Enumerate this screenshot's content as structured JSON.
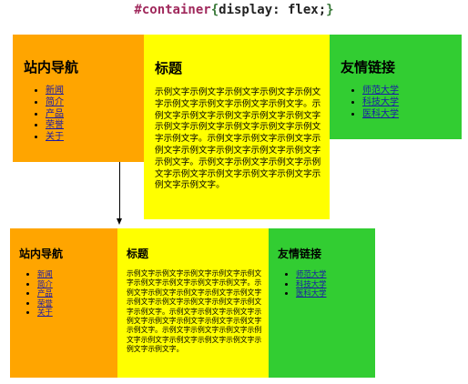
{
  "caption": {
    "selector": "#container",
    "open_brace": "{",
    "declaration": "display: flex;",
    "close_brace": "}"
  },
  "demos": [
    {
      "nav": {
        "title": "站内导航",
        "links": [
          "新闻",
          "简介",
          "产品",
          "荣誉",
          "关于"
        ]
      },
      "main": {
        "title": "标题",
        "text": "示例文字示例文字示例文字示例文字示例文字示例文字示例文字示例文字示例文字。示例文字示例文字示例文字示例文字示例文字示例文字示例文字示例文字示例文字示例文字示例文字。示例文字示例文字示例文字示例文字示例文字示例文字示例文字示例文字示例文字。示例文字示例文字示例文字示例文字示例文字示例文字示例文字示例文字示例文字示例文字。"
      },
      "links": {
        "title": "友情链接",
        "items": [
          "师范大学",
          "科技大学",
          "医科大学"
        ]
      }
    },
    {
      "nav": {
        "title": "站内导航",
        "links": [
          "新闻",
          "简介",
          "产品",
          "荣誉",
          "关于"
        ]
      },
      "main": {
        "title": "标题",
        "text": "示例文字示例文字示例文字示例文字示例文字示例文字示例文字示例文字示例文字。示例文字示例文字示例文字示例文字示例文字示例文字示例文字示例文字示例文字示例文字示例文字。示例文字示例文字示例文字示例文字示例文字示例文字示例文字示例文字示例文字。示例文字示例文字示例文字示例文字示例文字示例文字示例文字示例文字示例文字示例文字。"
      },
      "links": {
        "title": "友情链接",
        "items": [
          "师范大学",
          "科技大学",
          "医科大学"
        ]
      }
    }
  ],
  "colors": {
    "nav_bg": "#ffa500",
    "main_bg": "#ffff00",
    "links_bg": "#32cd32",
    "link_text": "#1a1aa8"
  }
}
